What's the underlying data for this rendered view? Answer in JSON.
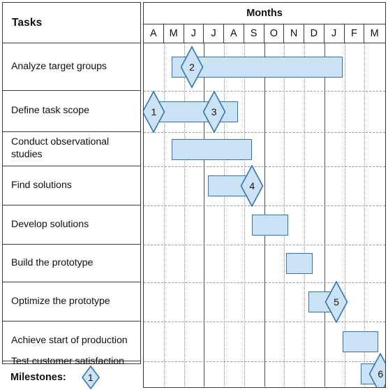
{
  "header": {
    "tasks_label": "Tasks",
    "months_label": "Months"
  },
  "months": [
    {
      "label": "A"
    },
    {
      "label": "M"
    },
    {
      "label": "J"
    },
    {
      "label": "J"
    },
    {
      "label": "A"
    },
    {
      "label": "S"
    },
    {
      "label": "O"
    },
    {
      "label": "N"
    },
    {
      "label": "D"
    },
    {
      "label": "J"
    },
    {
      "label": "F"
    },
    {
      "label": "M"
    }
  ],
  "legend": {
    "label": "Milestones:",
    "sample_number": "1"
  },
  "colors": {
    "bar_fill": "#cce3f5",
    "bar_border": "#2e75b6",
    "grid": "#9a9a9a",
    "quarter_line": "#555555",
    "frame": "#3a3a3a",
    "text": "#111111"
  },
  "tasks": [
    {
      "label": "Analyze target groups"
    },
    {
      "label": "Define task scope"
    },
    {
      "label": "Conduct observational studies"
    },
    {
      "label": "Find solutions"
    },
    {
      "label": "Develop solutions"
    },
    {
      "label": "Build the prototype"
    },
    {
      "label": "Optimize the prototype"
    },
    {
      "label": "Achieve start of production"
    },
    {
      "label": "Test customer satisfaction"
    }
  ],
  "chart_data": {
    "type": "bar",
    "title": "Months",
    "xlabel": "Months",
    "ylabel": "Tasks",
    "categories": [
      "Analyze target groups",
      "Define task scope",
      "Conduct observational studies",
      "Find solutions",
      "Develop solutions",
      "Build the prototype",
      "Optimize the prototype",
      "Achieve start of production",
      "Test customer satisfaction"
    ],
    "x_tick_labels": [
      "A",
      "M",
      "J",
      "J",
      "A",
      "S",
      "O",
      "N",
      "D",
      "J",
      "F",
      "M"
    ],
    "xlim": [
      0,
      12
    ],
    "grid": true,
    "legend_position": "bottom-left",
    "bars": [
      {
        "task": "Analyze target groups",
        "start_month": 1.4,
        "end_month": 9.9
      },
      {
        "task": "Define task scope",
        "start_month": 0.5,
        "end_month": 4.7
      },
      {
        "task": "Conduct observational studies",
        "start_month": 1.4,
        "end_month": 5.4
      },
      {
        "task": "Find solutions",
        "start_month": 3.2,
        "end_month": 5.4
      },
      {
        "task": "Develop solutions",
        "start_month": 5.4,
        "end_month": 7.2
      },
      {
        "task": "Build the prototype",
        "start_month": 7.1,
        "end_month": 8.4
      },
      {
        "task": "Optimize the prototype",
        "start_month": 8.2,
        "end_month": 9.6
      },
      {
        "task": "Achieve start of production",
        "start_month": 9.9,
        "end_month": 11.7
      },
      {
        "task": "Test customer satisfaction",
        "start_month": 10.8,
        "end_month": 11.8
      }
    ],
    "milestones": [
      {
        "number": "1",
        "task": "Define task scope",
        "month": 0.5
      },
      {
        "number": "2",
        "task": "Analyze target groups",
        "month": 2.4
      },
      {
        "number": "3",
        "task": "Define task scope",
        "month": 3.5
      },
      {
        "number": "4",
        "task": "Find solutions",
        "month": 5.4
      },
      {
        "number": "5",
        "task": "Optimize the prototype",
        "month": 9.6
      },
      {
        "number": "6",
        "task": "Test customer satisfaction",
        "month": 11.8
      }
    ]
  }
}
